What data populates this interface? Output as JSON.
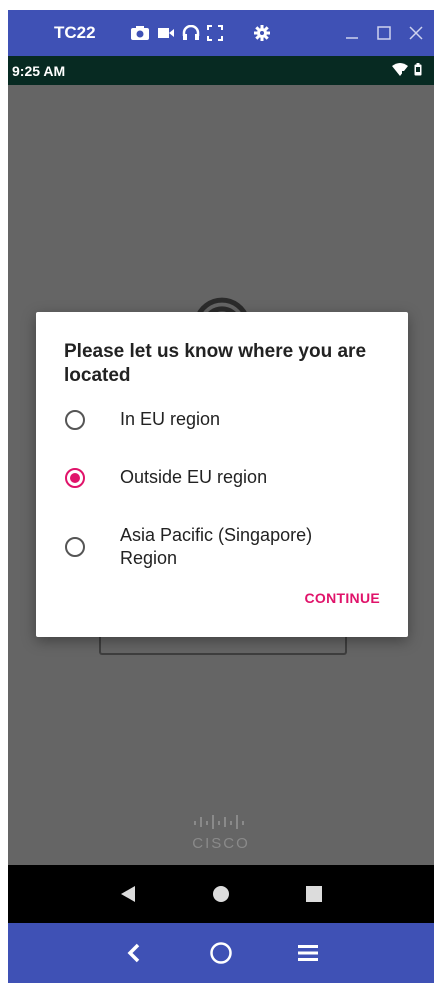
{
  "emulator": {
    "title": "TC22",
    "tools": [
      "camera-icon",
      "video-icon",
      "headset-icon",
      "fullscreen-icon",
      "gear-icon"
    ],
    "window_controls": [
      "minimize-icon",
      "maximize-icon",
      "close-icon"
    ]
  },
  "status_bar": {
    "time": "9:25 AM",
    "icons": [
      "wifi-icon",
      "battery-icon"
    ]
  },
  "dialog": {
    "title": "Please let us know where you are located",
    "options": [
      {
        "label": "In EU region",
        "selected": false
      },
      {
        "label": "Outside EU region",
        "selected": true
      },
      {
        "label": "Asia Pacific (Singapore) Region",
        "selected": false
      }
    ],
    "continue_label": "CONTINUE"
  },
  "background": {
    "brand_word": "CISCO"
  },
  "colors": {
    "emulator_bar": "#3f51b5",
    "status_bar": "#072a22",
    "accent": "#e0136a",
    "scrim": "#656565"
  },
  "nav_bar": {
    "buttons": [
      "back-icon",
      "home-icon",
      "recents-icon"
    ]
  },
  "emulator_bottom": {
    "buttons": [
      "back-chevron-icon",
      "home-circle-icon",
      "menu-icon"
    ]
  }
}
